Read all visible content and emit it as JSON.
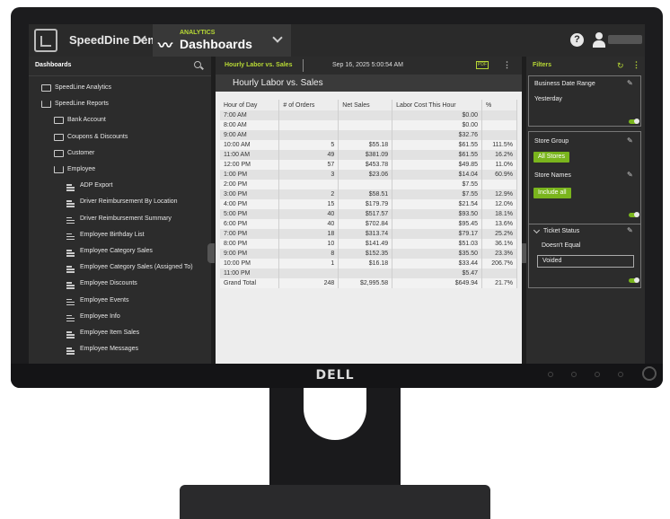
{
  "topbar": {
    "app_name": "SpeedDine Demo",
    "section_small": "ANALYTICS",
    "section_big": "Dashboards",
    "help_glyph": "?"
  },
  "sidebar": {
    "title": "Dashboards",
    "items": [
      {
        "label": "SpeedLine Analytics",
        "type": "folder",
        "depth": 0
      },
      {
        "label": "SpeedLine Reports",
        "type": "folder-open",
        "depth": 0
      },
      {
        "label": "Bank Account",
        "type": "folder",
        "depth": 1
      },
      {
        "label": "Coupons & Discounts",
        "type": "folder",
        "depth": 1
      },
      {
        "label": "Customer",
        "type": "folder",
        "depth": 1
      },
      {
        "label": "Employee",
        "type": "folder-open",
        "depth": 1
      },
      {
        "label": "ADP Export",
        "type": "report",
        "depth": 2
      },
      {
        "label": "Driver Reimbursement By Location",
        "type": "report",
        "depth": 2
      },
      {
        "label": "Driver Reimbursement Summary",
        "type": "report",
        "depth": 2
      },
      {
        "label": "Employee Birthday List",
        "type": "report",
        "depth": 2
      },
      {
        "label": "Employee Category Sales",
        "type": "report",
        "depth": 2
      },
      {
        "label": "Employee Category Sales (Assigned To)",
        "type": "report",
        "depth": 2
      },
      {
        "label": "Employee Discounts",
        "type": "report",
        "depth": 2
      },
      {
        "label": "Employee Events",
        "type": "report",
        "depth": 2
      },
      {
        "label": "Employee Info",
        "type": "report",
        "depth": 2
      },
      {
        "label": "Employee Item Sales",
        "type": "report",
        "depth": 2
      },
      {
        "label": "Employee Messages",
        "type": "report",
        "depth": 2
      }
    ]
  },
  "content": {
    "tab_title": "Hourly Labor vs. Sales",
    "timestamp": "Sep 16, 2025 5:00:54 AM",
    "pdf_label": "PDF",
    "menu_glyph": "⋮",
    "report_title": "Hourly Labor vs. Sales",
    "table": {
      "headers": [
        "Hour of Day",
        "# of Orders",
        "Net Sales",
        "Labor Cost This Hour",
        "%"
      ],
      "rows": [
        [
          "7:00 AM",
          "",
          "",
          "$0.00",
          ""
        ],
        [
          "8:00 AM",
          "",
          "",
          "$0.00",
          ""
        ],
        [
          "9:00 AM",
          "",
          "",
          "$32.76",
          ""
        ],
        [
          "10:00 AM",
          "5",
          "$55.18",
          "$61.55",
          "111.5%"
        ],
        [
          "11:00 AM",
          "49",
          "$381.09",
          "$61.55",
          "16.2%"
        ],
        [
          "12:00 PM",
          "57",
          "$453.78",
          "$49.85",
          "11.0%"
        ],
        [
          "1:00 PM",
          "3",
          "$23.06",
          "$14.04",
          "60.9%"
        ],
        [
          "2:00 PM",
          "",
          "",
          "$7.55",
          ""
        ],
        [
          "3:00 PM",
          "2",
          "$58.51",
          "$7.55",
          "12.9%"
        ],
        [
          "4:00 PM",
          "15",
          "$179.79",
          "$21.54",
          "12.0%"
        ],
        [
          "5:00 PM",
          "40",
          "$517.57",
          "$93.50",
          "18.1%"
        ],
        [
          "6:00 PM",
          "40",
          "$702.84",
          "$95.45",
          "13.6%"
        ],
        [
          "7:00 PM",
          "18",
          "$313.74",
          "$79.17",
          "25.2%"
        ],
        [
          "8:00 PM",
          "10",
          "$141.49",
          "$51.03",
          "36.1%"
        ],
        [
          "9:00 PM",
          "8",
          "$152.35",
          "$35.50",
          "23.3%"
        ],
        [
          "10:00 PM",
          "1",
          "$16.18",
          "$33.44",
          "206.7%"
        ],
        [
          "11:00 PM",
          "",
          "",
          "$5.47",
          ""
        ]
      ],
      "total": [
        "Grand Total",
        "248",
        "$2,995.58",
        "$649.94",
        "21.7%"
      ]
    }
  },
  "filters": {
    "title": "Filters",
    "refresh_glyph": "↻",
    "menu_glyph": "⋮",
    "business_date": {
      "title": "Business Date Range",
      "value": "Yesterday"
    },
    "store_group": {
      "title": "Store Group",
      "button": "All Stores"
    },
    "store_names": {
      "title": "Store Names",
      "button": "Include all"
    },
    "ticket_status": {
      "title": "Ticket Status",
      "operator": "Doesn't Equal",
      "value": "Voided"
    },
    "edit_glyph": "✎"
  },
  "monitor": {
    "brand": "DELL"
  },
  "colors": {
    "accent": "#b8d935",
    "button_green": "#7ab51d",
    "panel": "#2c2c2c"
  }
}
